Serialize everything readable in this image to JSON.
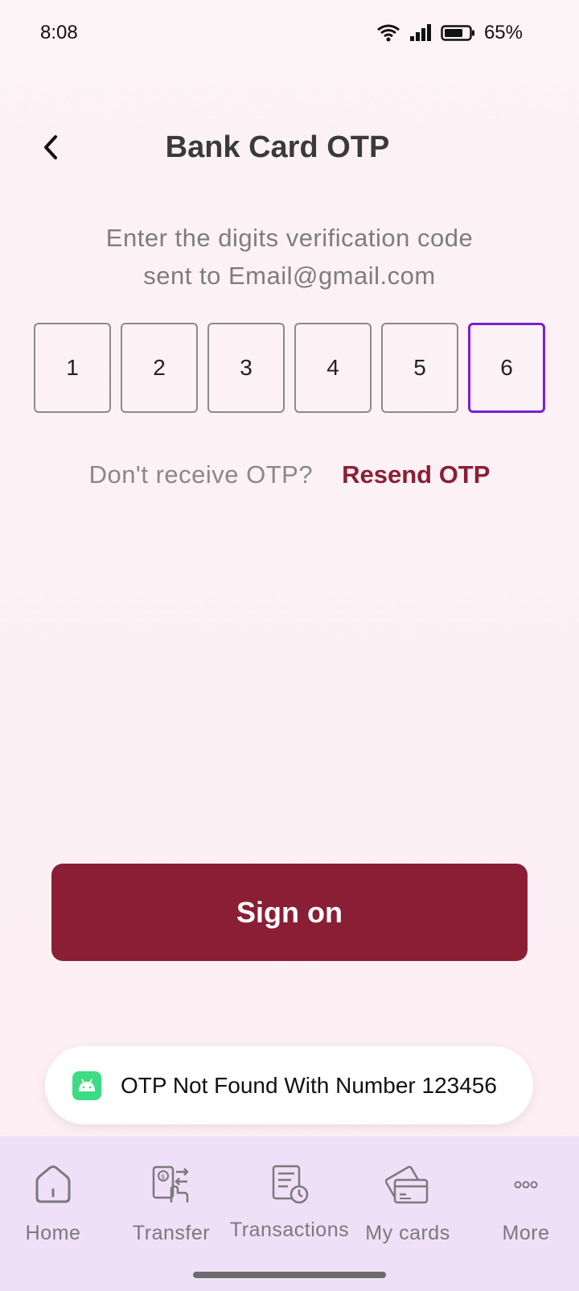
{
  "status_bar": {
    "time": "8:08",
    "battery": "65%",
    "icons": [
      "wifi-icon",
      "signal-icon",
      "battery-icon"
    ]
  },
  "header": {
    "title": "Bank Card OTP",
    "back_icon": "chevron-left-icon"
  },
  "subtitle": {
    "line1": "Enter the digits verification code",
    "line2": "sent to Email@gmail.com"
  },
  "otp": {
    "digits": [
      "1",
      "2",
      "3",
      "4",
      "5",
      "6"
    ],
    "active_index": 5
  },
  "resend": {
    "question": "Don't receive OTP?",
    "link": "Resend OTP"
  },
  "sign_on_button": "Sign on",
  "toast": {
    "message": "OTP Not Found With Number 123456",
    "icon": "android-icon"
  },
  "nav": {
    "items": [
      {
        "label": "Home",
        "icon": "home-icon"
      },
      {
        "label": "Transfer",
        "icon": "transfer-icon"
      },
      {
        "label": "Transactions",
        "icon": "transactions-icon"
      },
      {
        "label": "My cards",
        "icon": "cards-icon"
      },
      {
        "label": "More",
        "icon": "more-icon"
      }
    ]
  },
  "colors": {
    "primary": "#8a1e35",
    "otp_active_border": "#7b1fd1",
    "nav_background": "#efdff7",
    "background": "#fdf0f4"
  }
}
